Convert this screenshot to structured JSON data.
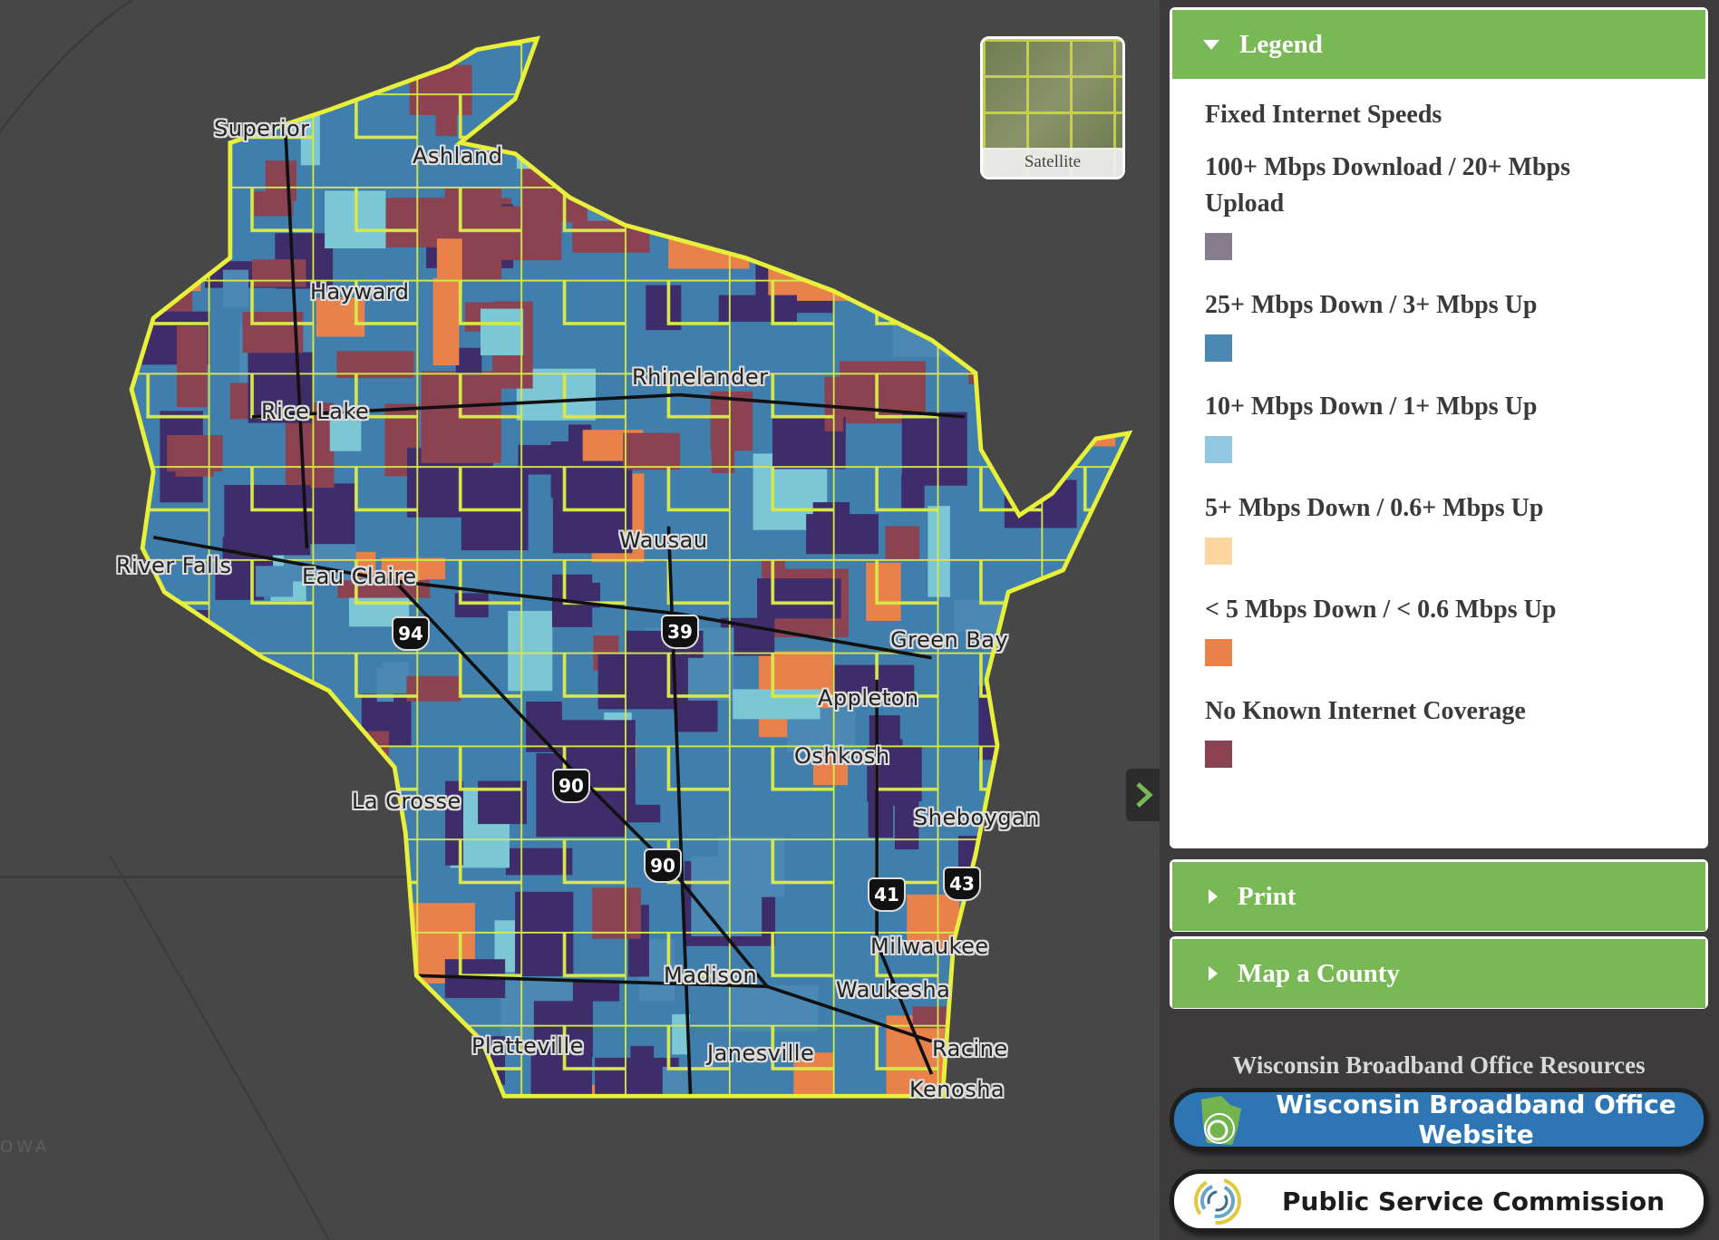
{
  "map": {
    "cities": [
      "Superior",
      "Ashland",
      "Hayward",
      "Rhinelander",
      "Rice Lake",
      "Wausau",
      "River Falls",
      "Eau Claire",
      "Green Bay",
      "Appleton",
      "Oshkosh",
      "La Crosse",
      "Sheboygan",
      "Milwaukee",
      "Madison",
      "Waukesha",
      "Platteville",
      "Janesville",
      "Racine",
      "Kenosha"
    ],
    "highways": [
      "94",
      "39",
      "90",
      "90",
      "41",
      "43"
    ],
    "neighbor_label": "OWA",
    "basemap_toggle": "Satellite",
    "colors": {
      "outline": "#e8f03a",
      "county_lines": "#d7e84a",
      "roads": "#111111",
      "background": "#474747"
    }
  },
  "legend": {
    "header": "Legend",
    "title": "Fixed Internet Speeds",
    "items": [
      {
        "label": "100+ Mbps Download / 20+ Mbps Upload",
        "color": "#857c8c"
      },
      {
        "label": "25+ Mbps Down / 3+ Mbps Up",
        "color": "#4b89b4"
      },
      {
        "label": "10+ Mbps Down / 1+ Mbps Up",
        "color": "#90c8e2"
      },
      {
        "label": "5+ Mbps Down / 0.6+ Mbps Up",
        "color": "#fdd59e"
      },
      {
        "label": "< 5 Mbps Down / < 0.6 Mbps Up",
        "color": "#e8824a"
      },
      {
        "label": "No Known Internet Coverage",
        "color": "#8b4352"
      }
    ]
  },
  "print": {
    "header": "Print"
  },
  "county": {
    "header": "Map a County"
  },
  "resources": {
    "title": "Wisconsin Broadband Office Resources",
    "website": "Wisconsin Broadband Office Website",
    "psc": "Public Service Commission"
  },
  "colors": {
    "accent": "#79b955",
    "website_button": "#2d76b3"
  }
}
